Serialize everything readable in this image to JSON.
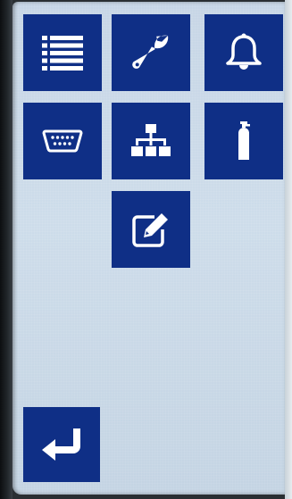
{
  "menu": {
    "tiles": [
      {
        "icon": "list-icon"
      },
      {
        "icon": "wrench-icon"
      },
      {
        "icon": "bell-icon"
      },
      {
        "icon": "serial-port-icon"
      },
      {
        "icon": "network-icon"
      },
      {
        "icon": "gas-cylinder-icon"
      },
      {
        "icon": "edit-icon"
      }
    ],
    "back": {
      "icon": "return-arrow-icon"
    }
  },
  "colors": {
    "tile": "#0f2f86",
    "icon": "#ffffff",
    "screen": "#c7d6e6"
  }
}
